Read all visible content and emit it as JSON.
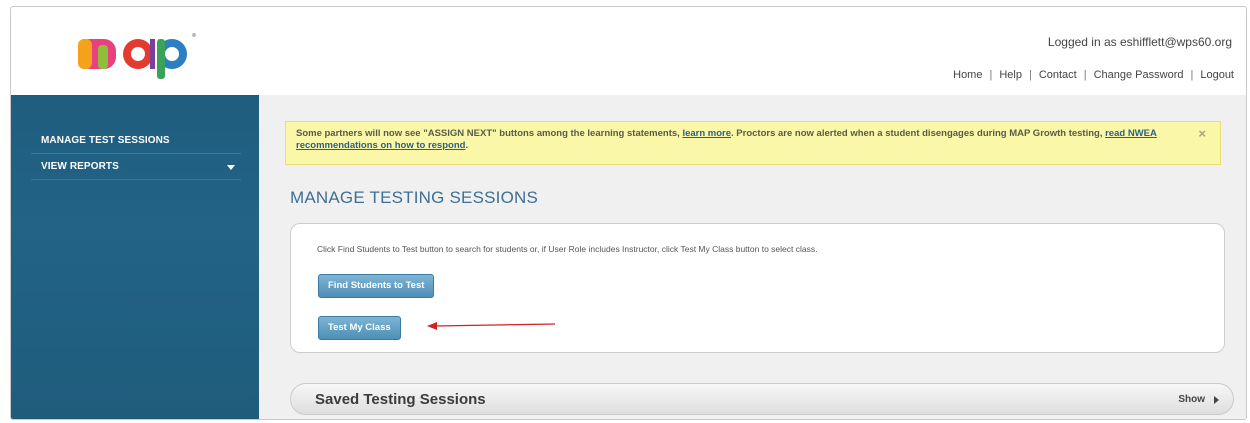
{
  "header": {
    "logo_text": "map",
    "logged_in": "Logged in as eshifflett@wps60.org",
    "links": [
      "Home",
      "Help",
      "Contact",
      "Change Password",
      "Logout"
    ]
  },
  "sidebar": {
    "items": [
      {
        "label": "MANAGE TEST SESSIONS"
      },
      {
        "label": "VIEW REPORTS"
      }
    ]
  },
  "notice": {
    "text1": "Some partners will now see \"ASSIGN NEXT\" buttons among the learning statements, ",
    "link1": "learn more",
    "text2": ". Proctors are now alerted when a student disengages during MAP Growth testing, ",
    "link2": "read NWEA recommendations on how to respond",
    "text3": ".",
    "close": "×"
  },
  "main": {
    "title": "MANAGE TESTING SESSIONS",
    "instructions": "Click Find Students to Test button to search for students or, if User Role includes Instructor, click Test My Class button to select class.",
    "find_button": "Find Students to Test",
    "test_class_button": "Test My Class"
  },
  "saved": {
    "title": "Saved Testing Sessions",
    "show": "Show"
  },
  "colors": {
    "sidebar": "#226386",
    "title": "#3e6f94",
    "notice_bg": "#fbf7a8",
    "annotation_arrow": "#d42020"
  }
}
